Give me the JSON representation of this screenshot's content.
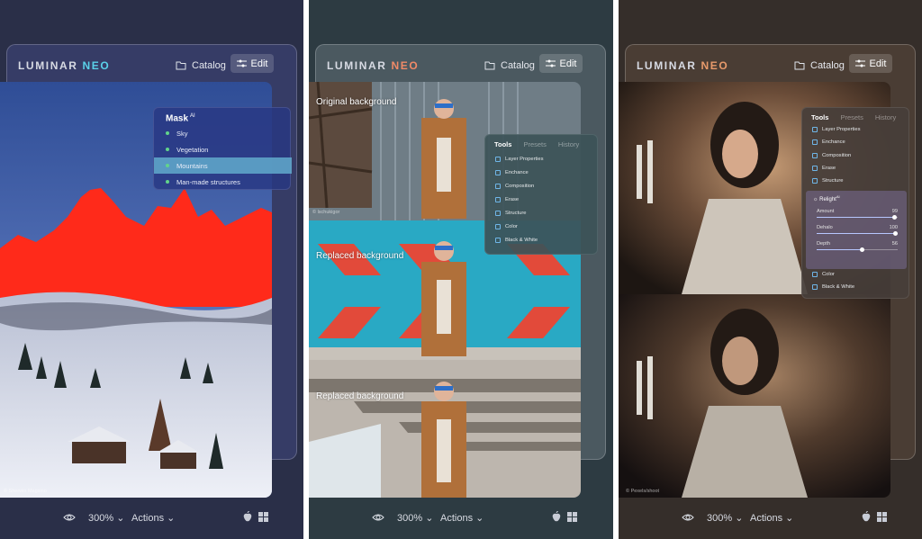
{
  "app": {
    "logo_main": "LUMINAR",
    "logo_accent": "NEO"
  },
  "toolbar": {
    "catalog_label": "Catalog",
    "edit_label": "Edit"
  },
  "bottom": {
    "zoom": "300%",
    "actions": "Actions"
  },
  "panel1": {
    "mask_title": "Mask",
    "mask_sup": "AI",
    "mask_items": [
      {
        "label": "Sky"
      },
      {
        "label": "Vegetation"
      },
      {
        "label": "Mountains",
        "active": true
      },
      {
        "label": "Man-made structures"
      }
    ],
    "credit": "© Sherwin Magsino"
  },
  "panel2": {
    "labels": [
      "Original background",
      "Replaced background",
      "Replaced background"
    ],
    "credit": "© lschukigor",
    "tabs": [
      "Tools",
      "Presets",
      "History"
    ],
    "tools": [
      "Layer Properties",
      "Enchance",
      "Composition",
      "Erase",
      "Structure",
      "Color",
      "Black & White"
    ]
  },
  "panel3": {
    "tabs": [
      "Tools",
      "Presets",
      "History"
    ],
    "tools_top": [
      "Layer Properties",
      "Enchance",
      "Composition",
      "Erase",
      "Structure"
    ],
    "relight_title": "Relight",
    "relight_sup": "AI",
    "sliders": [
      {
        "label": "Amount",
        "value": "99"
      },
      {
        "label": "Dehalo",
        "value": "100"
      },
      {
        "label": "Depth",
        "value": "56"
      }
    ],
    "tools_bottom": [
      "Color",
      "Black & White"
    ],
    "credit": "© Pexels/shoot"
  },
  "colors": {
    "accent_teal": "#5ad1e9",
    "accent_orange": "#f08a67",
    "mask_red": "#ff2a1a"
  }
}
